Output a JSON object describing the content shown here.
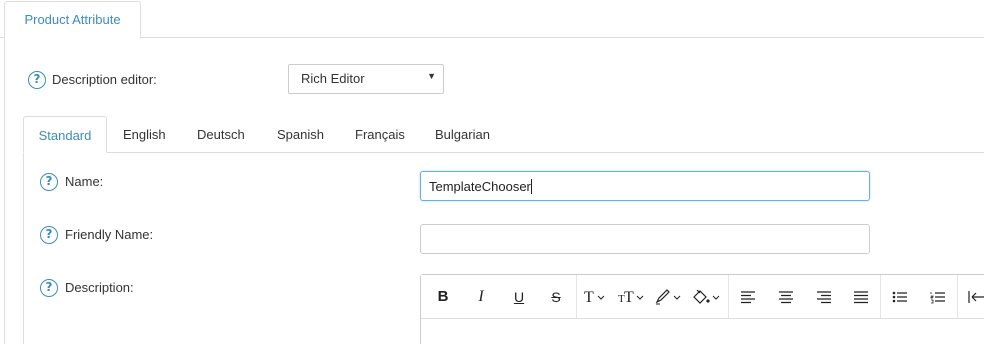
{
  "outer_tab": {
    "label": "Product Attribute"
  },
  "description_editor": {
    "label": "Description editor:",
    "selected": "Rich Editor"
  },
  "language_tabs": [
    {
      "label": "Standard",
      "active": true
    },
    {
      "label": "English"
    },
    {
      "label": "Deutsch"
    },
    {
      "label": "Spanish"
    },
    {
      "label": "Français"
    },
    {
      "label": "Bulgarian"
    }
  ],
  "fields": {
    "name": {
      "label": "Name:",
      "value": "TemplateChooser"
    },
    "friendly_name": {
      "label": "Friendly Name:",
      "value": ""
    },
    "description": {
      "label": "Description:"
    }
  },
  "toolbar": {
    "bold": "B",
    "italic": "I",
    "underline": "U",
    "strikethrough": "S",
    "icons": [
      "bold-icon",
      "italic-icon",
      "underline-icon",
      "strikethrough-icon",
      "font-family-icon",
      "font-size-icon",
      "text-color-icon",
      "background-color-icon",
      "align-left-icon",
      "align-center-icon",
      "align-right-icon",
      "align-justify-icon",
      "unordered-list-icon",
      "ordered-list-icon",
      "outdent-icon"
    ]
  },
  "colors": {
    "accent": "#3c8dbc",
    "border": "#dddddd"
  }
}
